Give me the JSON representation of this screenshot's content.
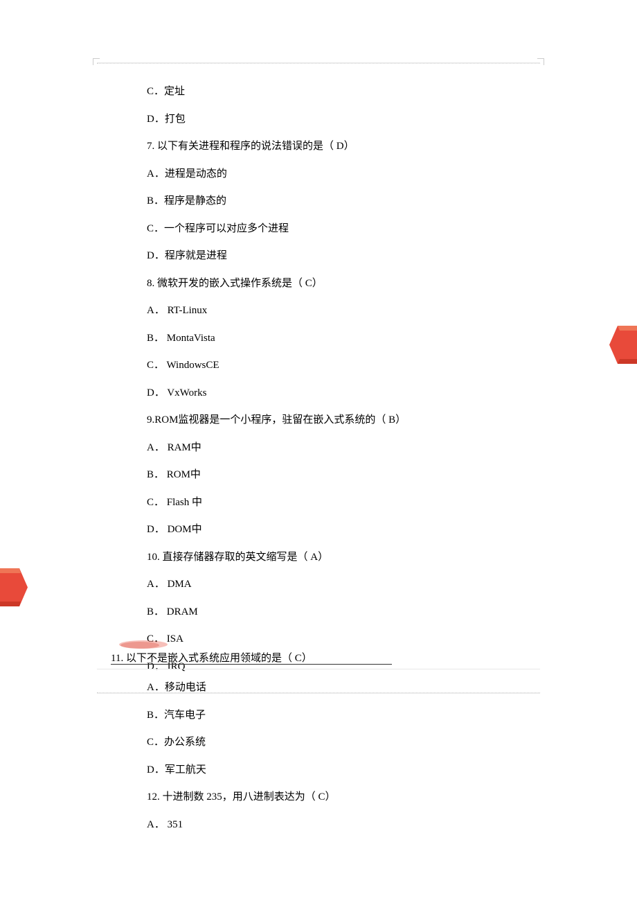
{
  "q6": {
    "optC": "C．定址",
    "optD": "D．打包"
  },
  "q7": {
    "question": "7. 以下有关进程和程序的说法错误的是（   D）",
    "optA": "A．进程是动态的",
    "optB": "B．程序是静态的",
    "optC": "C．一个程序可以对应多个进程",
    "optD": "D．程序就是进程"
  },
  "q8": {
    "question": "8. 微软开发的嵌入式操作系统是（   C）",
    "optA": "A． RT-Linux",
    "optB": "B． MontaVista",
    "optC": "C． WindowsCE",
    "optD": "D． VxWorks"
  },
  "q9": {
    "question": "9.ROM监视器是一个小程序，驻留在嵌入式系统的（    B）",
    "optA": "A． RAM中",
    "optB": "B． ROM中",
    "optC": "C． Flash 中",
    "optD": "D． DOM中"
  },
  "q10": {
    "question": "10. 直接存储器存取的英文缩写是（   A）",
    "optA": "A． DMA",
    "optB": "B． DRAM",
    "optC": "C． ISA",
    "optD": "D． IRQ"
  },
  "q11": {
    "question": "11. 以下不是嵌入式系统应用领域的是（   C）",
    "optA": "A．移动电话",
    "optB": "B．汽车电子",
    "optC": "C．办公系统",
    "optD": "D．军工航天"
  },
  "q12": {
    "question": "12. 十进制数  235，用八进制表达为（  C）",
    "optA": "A． 351"
  }
}
